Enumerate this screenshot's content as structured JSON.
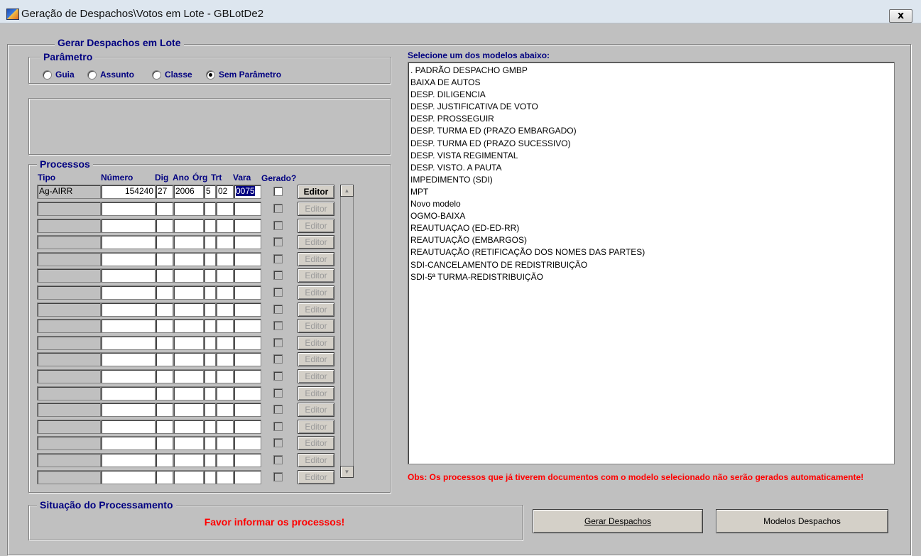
{
  "window": {
    "title": "Geração de Despachos\\Votos em Lote - GBLotDe2",
    "close_label": "x"
  },
  "gerar": {
    "legend": "Gerar Despachos em Lote"
  },
  "parametro": {
    "legend": "Parâmetro",
    "options": [
      {
        "label": "Guia",
        "checked": false
      },
      {
        "label": "Assunto",
        "checked": false
      },
      {
        "label": "Classe",
        "checked": false
      },
      {
        "label": "Sem Parâmetro",
        "checked": true
      }
    ]
  },
  "processos": {
    "legend": "Processos",
    "headers": {
      "tipo": "Tipo",
      "numero": "Número",
      "dig": "Dig",
      "ano": "Ano",
      "org": "Órg",
      "trt": "Trt",
      "vara": "Vara",
      "gerado": "Gerado?"
    },
    "editor_label": "Editor",
    "rows": [
      {
        "tipo": "Ag-AIRR",
        "numero": "154240",
        "dig": "27",
        "ano": "2006",
        "org": "5",
        "trt": "02",
        "vara": "0075"
      }
    ],
    "empty_rows": 17
  },
  "modelos": {
    "label": "Selecione um dos modelos abaixo:",
    "items": [
      ". PADRÃO DESPACHO GMBP",
      "BAIXA DE AUTOS",
      "DESP. DILIGENCIA",
      "DESP. JUSTIFICATIVA DE VOTO",
      "DESP. PROSSEGUIR",
      "DESP. TURMA ED (PRAZO EMBARGADO)",
      "DESP. TURMA ED (PRAZO SUCESSIVO)",
      "DESP. VISTA REGIMENTAL",
      "DESP. VISTO. A PAUTA",
      "IMPEDIMENTO (SDI)",
      "MPT",
      "Novo modelo",
      "OGMO-BAIXA",
      "REAUTUAÇAO (ED-ED-RR)",
      "REAUTUAÇÃO (EMBARGOS)",
      "REAUTUAÇÃO (RETIFICAÇÃO DOS NOMES DAS PARTES)",
      "SDI-CANCELAMENTO DE REDISTRIBUIÇÃO",
      "SDI-5ª TURMA-REDISTRIBUIÇÃO"
    ]
  },
  "obs": "Obs: Os processos que já tiverem documentos com o modelo selecionado não serão gerados automaticamente!",
  "situacao": {
    "legend": "Situação do Processamento",
    "message": "Favor informar os processos!"
  },
  "buttons": {
    "gerar": "Gerar Despachos",
    "modelos": "Modelos Despachos"
  },
  "colors": {
    "label_blue": "#000080",
    "warning_red": "#ff0000",
    "face": "#c0c0c0"
  }
}
